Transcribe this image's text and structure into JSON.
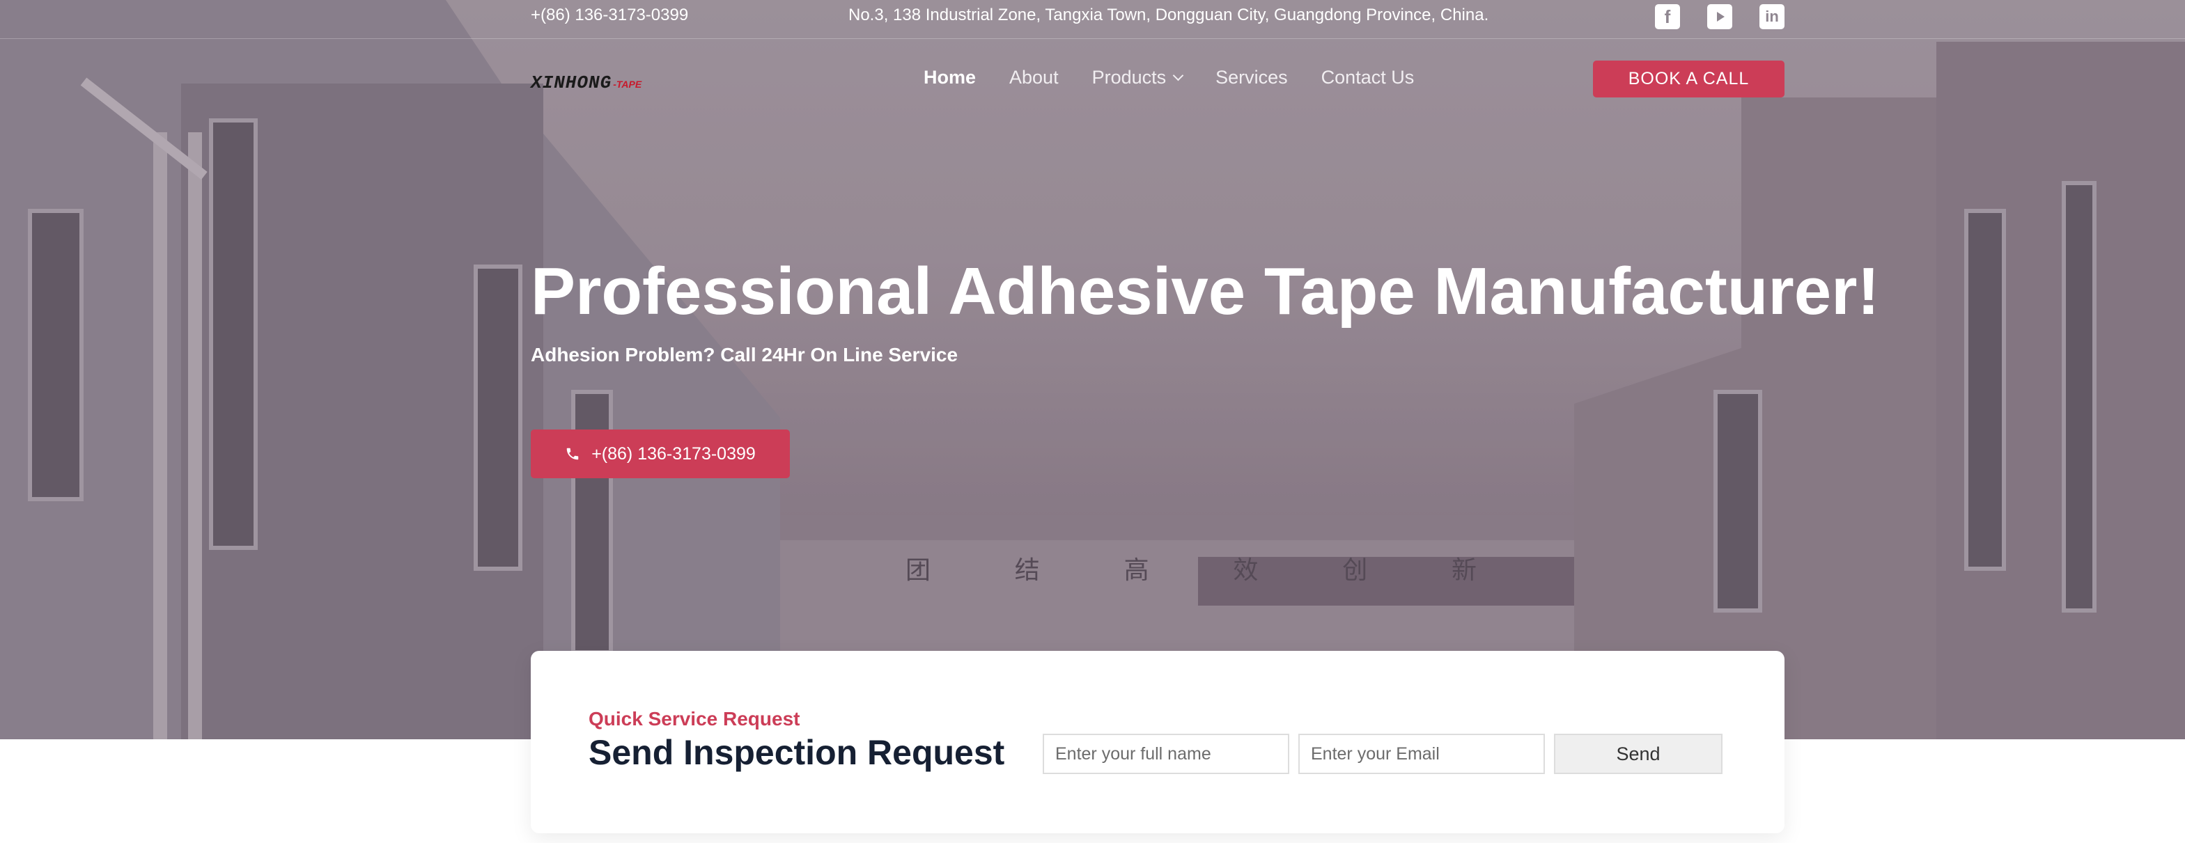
{
  "topbar": {
    "phone": "+(86)  136-3173-0399",
    "address": "No.3, 138 Industrial Zone, Tangxia Town, Dongguan City, Guangdong Province, China.",
    "social_icons": [
      "facebook-icon",
      "youtube-icon",
      "linkedin-icon"
    ]
  },
  "brand": {
    "logo_main": "XINHONG",
    "logo_suffix": "-TAPE"
  },
  "nav": {
    "items": [
      {
        "label": "Home",
        "active": true
      },
      {
        "label": "About"
      },
      {
        "label": "Products",
        "has_dropdown": true
      },
      {
        "label": "Services"
      },
      {
        "label": "Contact Us"
      }
    ],
    "cta_label": "BOOK A CALL"
  },
  "hero": {
    "headline": "Professional Adhesive Tape Manufacturer!",
    "subheadline": "Adhesion Problem? Call 24Hr On Line Service",
    "call_button_label": "+(86) 136-3173-0399",
    "building_sign": [
      "团",
      "结",
      "高",
      "效",
      "创",
      "新"
    ]
  },
  "service_request": {
    "eyebrow": "Quick Service Request",
    "title": "Send Inspection Request",
    "name_placeholder": "Enter your full name",
    "email_placeholder": "Enter your Email",
    "send_label": "Send"
  },
  "colors": {
    "accent": "#cc3d57",
    "title_text": "#162033",
    "overlay": "#8b7f89"
  }
}
